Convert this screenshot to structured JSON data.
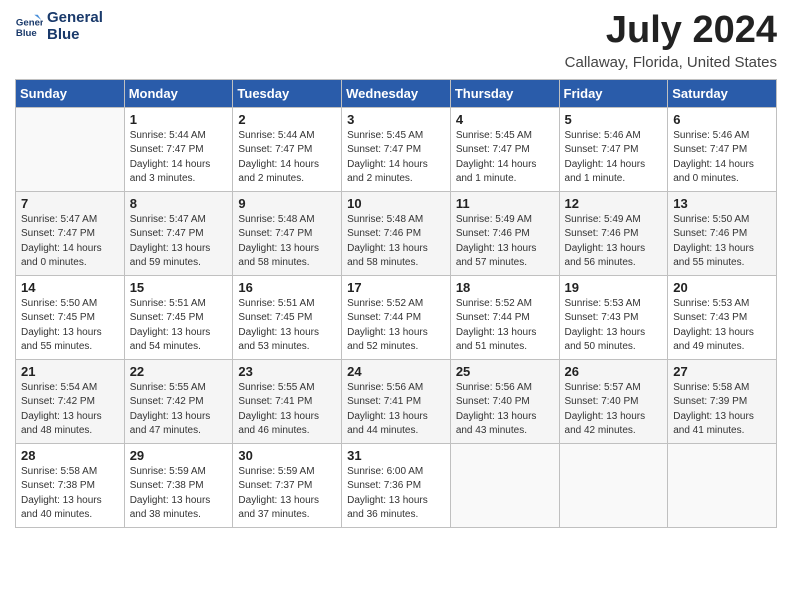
{
  "logo": {
    "line1": "General",
    "line2": "Blue"
  },
  "title": "July 2024",
  "location": "Callaway, Florida, United States",
  "headers": [
    "Sunday",
    "Monday",
    "Tuesday",
    "Wednesday",
    "Thursday",
    "Friday",
    "Saturday"
  ],
  "weeks": [
    [
      {
        "day": "",
        "info": ""
      },
      {
        "day": "1",
        "info": "Sunrise: 5:44 AM\nSunset: 7:47 PM\nDaylight: 14 hours\nand 3 minutes."
      },
      {
        "day": "2",
        "info": "Sunrise: 5:44 AM\nSunset: 7:47 PM\nDaylight: 14 hours\nand 2 minutes."
      },
      {
        "day": "3",
        "info": "Sunrise: 5:45 AM\nSunset: 7:47 PM\nDaylight: 14 hours\nand 2 minutes."
      },
      {
        "day": "4",
        "info": "Sunrise: 5:45 AM\nSunset: 7:47 PM\nDaylight: 14 hours\nand 1 minute."
      },
      {
        "day": "5",
        "info": "Sunrise: 5:46 AM\nSunset: 7:47 PM\nDaylight: 14 hours\nand 1 minute."
      },
      {
        "day": "6",
        "info": "Sunrise: 5:46 AM\nSunset: 7:47 PM\nDaylight: 14 hours\nand 0 minutes."
      }
    ],
    [
      {
        "day": "7",
        "info": "Sunrise: 5:47 AM\nSunset: 7:47 PM\nDaylight: 14 hours\nand 0 minutes."
      },
      {
        "day": "8",
        "info": "Sunrise: 5:47 AM\nSunset: 7:47 PM\nDaylight: 13 hours\nand 59 minutes."
      },
      {
        "day": "9",
        "info": "Sunrise: 5:48 AM\nSunset: 7:47 PM\nDaylight: 13 hours\nand 58 minutes."
      },
      {
        "day": "10",
        "info": "Sunrise: 5:48 AM\nSunset: 7:46 PM\nDaylight: 13 hours\nand 58 minutes."
      },
      {
        "day": "11",
        "info": "Sunrise: 5:49 AM\nSunset: 7:46 PM\nDaylight: 13 hours\nand 57 minutes."
      },
      {
        "day": "12",
        "info": "Sunrise: 5:49 AM\nSunset: 7:46 PM\nDaylight: 13 hours\nand 56 minutes."
      },
      {
        "day": "13",
        "info": "Sunrise: 5:50 AM\nSunset: 7:46 PM\nDaylight: 13 hours\nand 55 minutes."
      }
    ],
    [
      {
        "day": "14",
        "info": "Sunrise: 5:50 AM\nSunset: 7:45 PM\nDaylight: 13 hours\nand 55 minutes."
      },
      {
        "day": "15",
        "info": "Sunrise: 5:51 AM\nSunset: 7:45 PM\nDaylight: 13 hours\nand 54 minutes."
      },
      {
        "day": "16",
        "info": "Sunrise: 5:51 AM\nSunset: 7:45 PM\nDaylight: 13 hours\nand 53 minutes."
      },
      {
        "day": "17",
        "info": "Sunrise: 5:52 AM\nSunset: 7:44 PM\nDaylight: 13 hours\nand 52 minutes."
      },
      {
        "day": "18",
        "info": "Sunrise: 5:52 AM\nSunset: 7:44 PM\nDaylight: 13 hours\nand 51 minutes."
      },
      {
        "day": "19",
        "info": "Sunrise: 5:53 AM\nSunset: 7:43 PM\nDaylight: 13 hours\nand 50 minutes."
      },
      {
        "day": "20",
        "info": "Sunrise: 5:53 AM\nSunset: 7:43 PM\nDaylight: 13 hours\nand 49 minutes."
      }
    ],
    [
      {
        "day": "21",
        "info": "Sunrise: 5:54 AM\nSunset: 7:42 PM\nDaylight: 13 hours\nand 48 minutes."
      },
      {
        "day": "22",
        "info": "Sunrise: 5:55 AM\nSunset: 7:42 PM\nDaylight: 13 hours\nand 47 minutes."
      },
      {
        "day": "23",
        "info": "Sunrise: 5:55 AM\nSunset: 7:41 PM\nDaylight: 13 hours\nand 46 minutes."
      },
      {
        "day": "24",
        "info": "Sunrise: 5:56 AM\nSunset: 7:41 PM\nDaylight: 13 hours\nand 44 minutes."
      },
      {
        "day": "25",
        "info": "Sunrise: 5:56 AM\nSunset: 7:40 PM\nDaylight: 13 hours\nand 43 minutes."
      },
      {
        "day": "26",
        "info": "Sunrise: 5:57 AM\nSunset: 7:40 PM\nDaylight: 13 hours\nand 42 minutes."
      },
      {
        "day": "27",
        "info": "Sunrise: 5:58 AM\nSunset: 7:39 PM\nDaylight: 13 hours\nand 41 minutes."
      }
    ],
    [
      {
        "day": "28",
        "info": "Sunrise: 5:58 AM\nSunset: 7:38 PM\nDaylight: 13 hours\nand 40 minutes."
      },
      {
        "day": "29",
        "info": "Sunrise: 5:59 AM\nSunset: 7:38 PM\nDaylight: 13 hours\nand 38 minutes."
      },
      {
        "day": "30",
        "info": "Sunrise: 5:59 AM\nSunset: 7:37 PM\nDaylight: 13 hours\nand 37 minutes."
      },
      {
        "day": "31",
        "info": "Sunrise: 6:00 AM\nSunset: 7:36 PM\nDaylight: 13 hours\nand 36 minutes."
      },
      {
        "day": "",
        "info": ""
      },
      {
        "day": "",
        "info": ""
      },
      {
        "day": "",
        "info": ""
      }
    ]
  ]
}
